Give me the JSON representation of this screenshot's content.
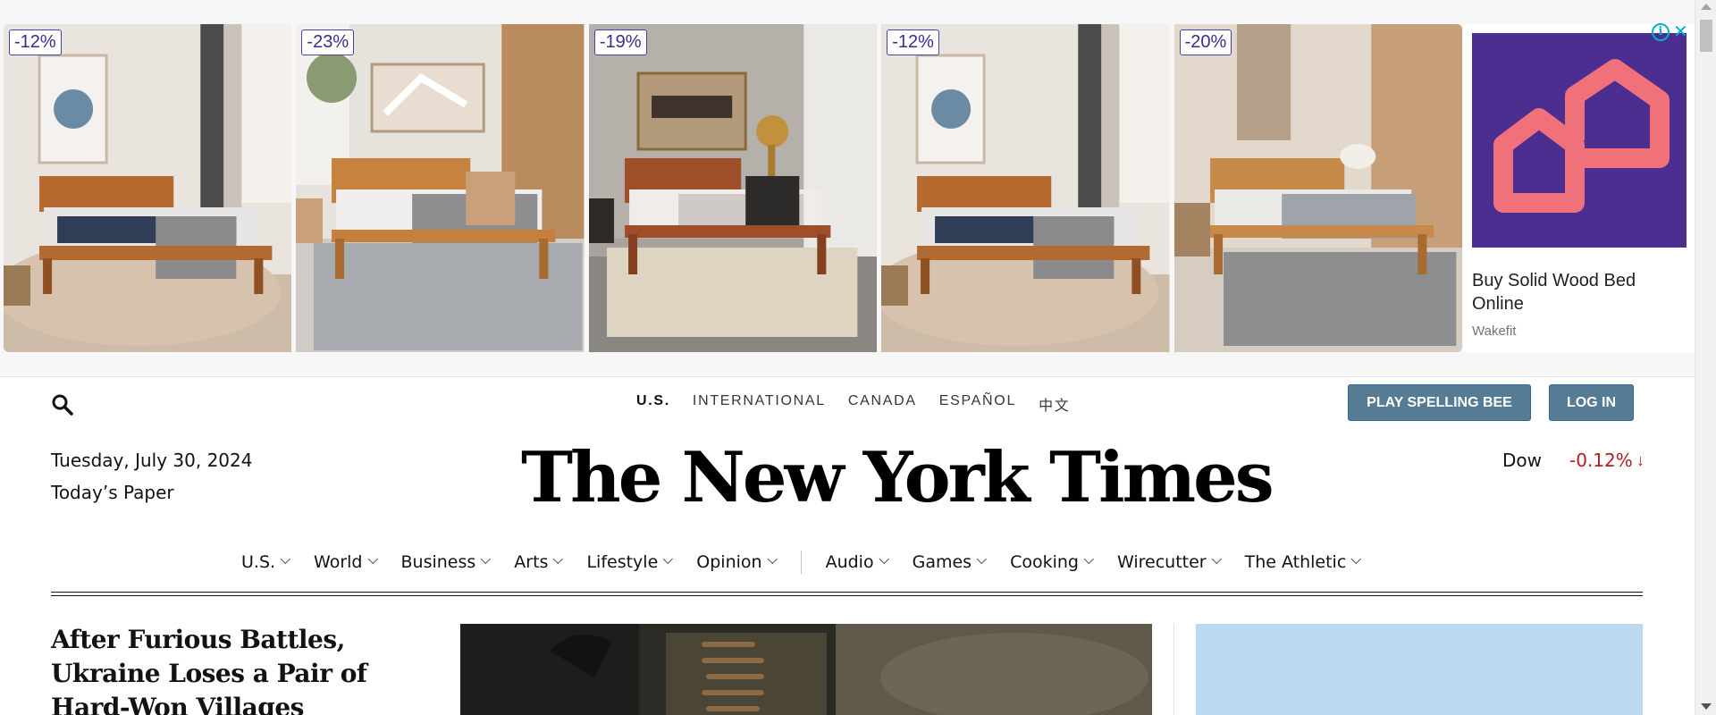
{
  "ad": {
    "discounts": [
      "-12%",
      "-23%",
      "-19%",
      "-12%",
      "-20%"
    ],
    "title": "Buy Solid Wood Bed Online",
    "advertiser": "Wakefit",
    "choices_icon": "ad-info-icon",
    "close_icon": "close-icon",
    "brand_color": "#4b2e8f",
    "logo_color": "#f0717a"
  },
  "masthead": {
    "editions": [
      "U.S.",
      "INTERNATIONAL",
      "CANADA",
      "ESPAÑOL",
      "中文"
    ],
    "active_edition": "U.S.",
    "play_button": "PLAY SPELLING BEE",
    "login_button": "LOG IN",
    "date": "Tuesday, July 30, 2024",
    "todays_paper": "Today’s Paper",
    "logo": "The New York Times",
    "ticker": {
      "name": "Dow",
      "value": "-0.12%",
      "direction": "down"
    },
    "button_color": "#567b95"
  },
  "nav": {
    "items": [
      "U.S.",
      "World",
      "Business",
      "Arts",
      "Lifestyle",
      "Opinion",
      "Audio",
      "Games",
      "Cooking",
      "Wirecutter",
      "The Athletic"
    ]
  },
  "lead": {
    "headline": "After Furious Battles, Ukraine Loses a Pair of Hard-Won Villages"
  }
}
